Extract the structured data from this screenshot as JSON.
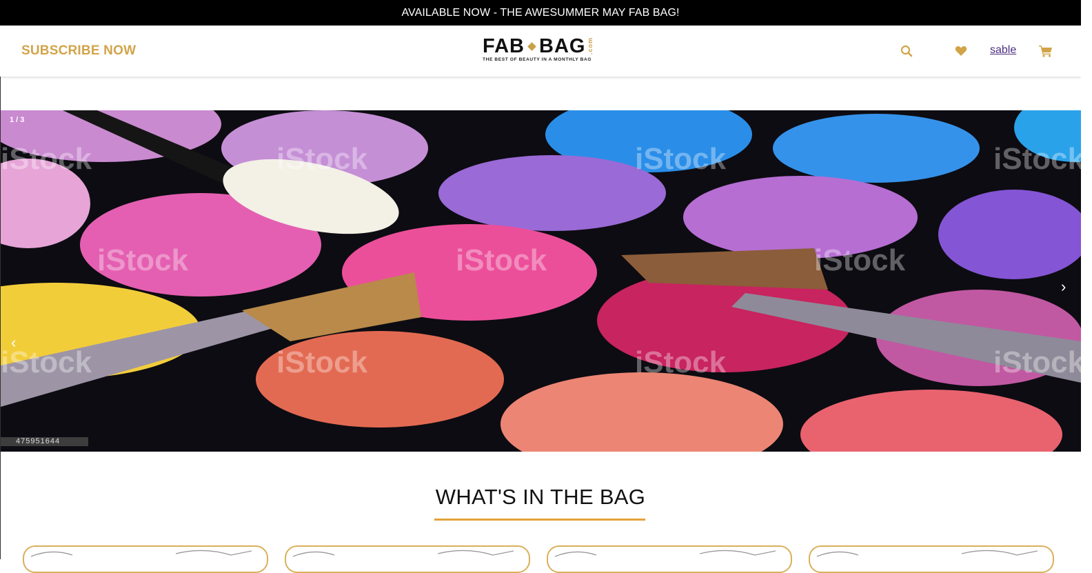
{
  "announcement": {
    "text": "AVAILABLE NOW - THE AWESUMMER MAY FAB BAG!"
  },
  "header": {
    "subscribe_label": "SUBSCRIBE NOW",
    "logo": {
      "main_left": "FAB",
      "main_right": "BAG",
      "suffix": ".com",
      "tagline": "THE BEST OF BEAUTY IN A MONTHLY BAG"
    },
    "icons": [
      "search-icon",
      "heart-icon",
      "cart-icon"
    ],
    "user_name": "sable"
  },
  "hero": {
    "slide_counter": "1 / 3",
    "prev_label": "‹",
    "next_label": "›",
    "stock_id": "475951644"
  },
  "section": {
    "title": "WHAT'S IN THE BAG"
  },
  "colors": {
    "accent_gold": "#d2a449",
    "underline_gold": "#e3a33a",
    "announce_bg": "#000000",
    "user_link": "#4b2e83"
  }
}
